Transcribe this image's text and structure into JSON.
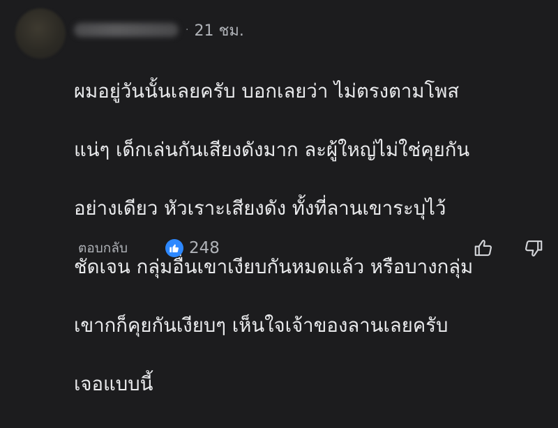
{
  "comment": {
    "author_name": "",
    "timestamp": "21 ชม.",
    "separator": "·",
    "text_lines": [
      "ผมอยู่วันนั้นเลยครับ บอกเลยว่า ไม่ตรงตามโพส",
      "แน่ๆ เด็กเล่นกันเสียงดังมาก ละผู้ใหญ่ไม่ใช่คุยกัน",
      "อย่างเดียว หัวเราะเสียงดัง ทั้งที่ลานเขาระบุไว้",
      "ชัดเจน กลุ่มอื่นเขาเงียบกันหมดแล้ว หรือบางกลุ่ม",
      "เขากก็คุยกันเงียบๆ เห็นใจเจ้าของลานเลยครับ",
      "เจอแบบนี้"
    ]
  },
  "footer": {
    "reply_label": "ตอบกลับ",
    "reaction_count": "248",
    "reaction_icon": "like-icon",
    "upvote_icon": "thumbs-up-icon",
    "downvote_icon": "thumbs-down-icon"
  },
  "colors": {
    "background": "#1c1c1e",
    "text": "#e9eaec",
    "secondary_text": "#b0b3b8",
    "like_blue": "#2d88ff"
  }
}
